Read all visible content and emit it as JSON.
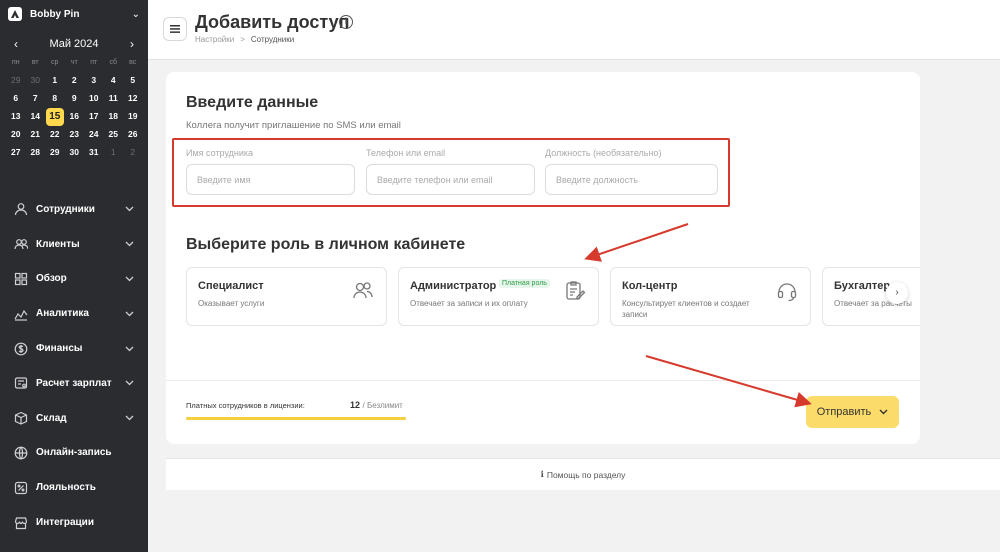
{
  "sidebar": {
    "account_name": "Bobby Pin",
    "calendar": {
      "month_label": "Май 2024",
      "weekdays": [
        "пн",
        "вт",
        "ср",
        "чт",
        "пт",
        "сб",
        "вс"
      ],
      "weeks": [
        [
          {
            "d": "29",
            "m": true
          },
          {
            "d": "30",
            "m": true
          },
          {
            "d": "1"
          },
          {
            "d": "2"
          },
          {
            "d": "3"
          },
          {
            "d": "4"
          },
          {
            "d": "5"
          }
        ],
        [
          {
            "d": "6"
          },
          {
            "d": "7"
          },
          {
            "d": "8"
          },
          {
            "d": "9"
          },
          {
            "d": "10"
          },
          {
            "d": "11"
          },
          {
            "d": "12"
          }
        ],
        [
          {
            "d": "13"
          },
          {
            "d": "14"
          },
          {
            "d": "15",
            "t": true
          },
          {
            "d": "16"
          },
          {
            "d": "17"
          },
          {
            "d": "18"
          },
          {
            "d": "19"
          }
        ],
        [
          {
            "d": "20"
          },
          {
            "d": "21"
          },
          {
            "d": "22"
          },
          {
            "d": "23"
          },
          {
            "d": "24"
          },
          {
            "d": "25"
          },
          {
            "d": "26"
          }
        ],
        [
          {
            "d": "27"
          },
          {
            "d": "28"
          },
          {
            "d": "29"
          },
          {
            "d": "30"
          },
          {
            "d": "31"
          },
          {
            "d": "1",
            "m": true
          },
          {
            "d": "2",
            "m": true
          }
        ]
      ]
    },
    "menu": [
      {
        "label": "Сотрудники",
        "icon": "user-icon",
        "chevron": true
      },
      {
        "label": "Клиенты",
        "icon": "users-icon",
        "chevron": true
      },
      {
        "label": "Обзор",
        "icon": "grid-icon",
        "chevron": true
      },
      {
        "label": "Аналитика",
        "icon": "chart-icon",
        "chevron": true
      },
      {
        "label": "Финансы",
        "icon": "dollar-icon",
        "chevron": true
      },
      {
        "label": "Расчет зарплат",
        "icon": "payroll-icon",
        "chevron": true
      },
      {
        "label": "Склад",
        "icon": "box-icon",
        "chevron": true
      },
      {
        "label": "Онлайн-запись",
        "icon": "globe-icon",
        "chevron": false
      },
      {
        "label": "Лояльность",
        "icon": "percent-icon",
        "chevron": false
      },
      {
        "label": "Интеграции",
        "icon": "store-icon",
        "chevron": false
      }
    ]
  },
  "header": {
    "title": "Добавить доступ",
    "breadcrumb": [
      "Настройки",
      "Сотрудники"
    ]
  },
  "form": {
    "section_title": "Введите данные",
    "subtitle": "Коллега получит приглашение по SMS или email",
    "fields": {
      "name": {
        "label": "Имя сотрудника",
        "placeholder": "Введите имя",
        "value": ""
      },
      "contact": {
        "label": "Телефон или email",
        "placeholder": "Введите телефон или email",
        "value": ""
      },
      "position": {
        "label": "Должность (необязательно)",
        "placeholder": "Введите должность",
        "value": ""
      }
    }
  },
  "roles": {
    "section_title": "Выберите роль в личном кабинете",
    "items": [
      {
        "title": "Специалист",
        "description": "Оказывает услуги",
        "icon": "people-icon",
        "badge": ""
      },
      {
        "title": "Администратор",
        "description": "Отвечает за записи и их оплату",
        "icon": "clipboard-edit-icon",
        "badge": "Платная роль"
      },
      {
        "title": "Кол-центр",
        "description": "Консультирует клиентов и создает записи",
        "icon": "headset-icon",
        "badge": ""
      },
      {
        "title": "Бухгалтер",
        "description": "Отвечает за расчеты",
        "icon": "calculator-icon",
        "badge": ""
      }
    ]
  },
  "license": {
    "label": "Платных сотрудников в лицензии:",
    "count": "12",
    "limit": "/ Безлимит"
  },
  "actions": {
    "send_label": "Отправить"
  },
  "help": {
    "label": "Помощь по разделу"
  },
  "colors": {
    "sidebar_bg": "#2b2c2f",
    "accent_yellow": "#fbdc6a",
    "annotation_red": "#d63a2c"
  }
}
